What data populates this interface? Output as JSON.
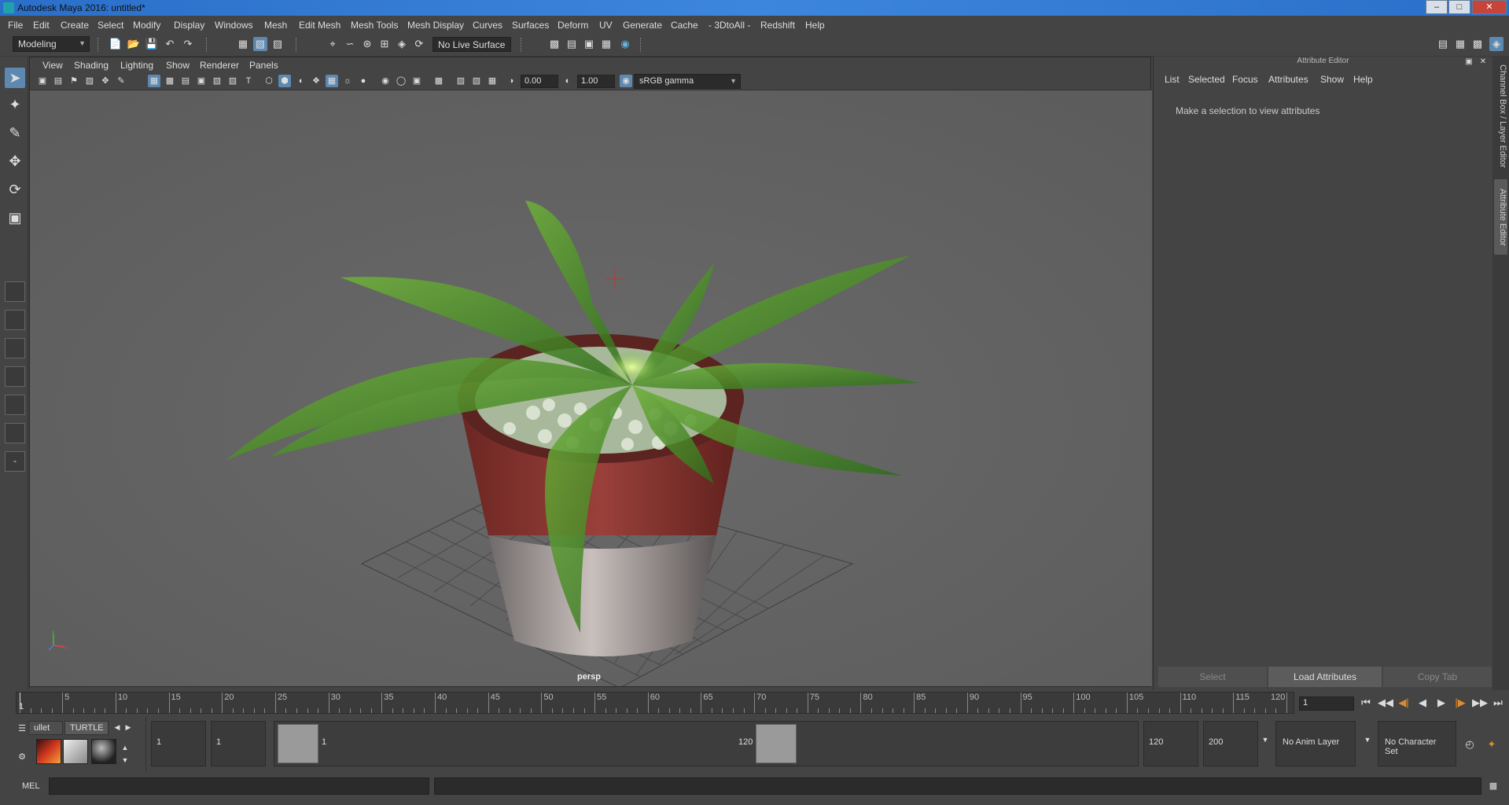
{
  "window": {
    "title": "Autodesk Maya 2016: untitled*"
  },
  "menubar": [
    "File",
    "Edit",
    "Create",
    "Select",
    "Modify",
    "Display",
    "Windows",
    "Mesh",
    "Edit Mesh",
    "Mesh Tools",
    "Mesh Display",
    "Curves",
    "Surfaces",
    "Deform",
    "UV",
    "Generate",
    "Cache",
    "- 3DtoAll -",
    "Redshift",
    "Help"
  ],
  "statusline": {
    "mode": "Modeling",
    "live_surface": "No Live Surface"
  },
  "viewport": {
    "menu": [
      "View",
      "Shading",
      "Lighting",
      "Show",
      "Renderer",
      "Panels"
    ],
    "exposure": "0.00",
    "gamma": "1.00",
    "color_space": "sRGB gamma",
    "camera": "persp"
  },
  "attribute_editor": {
    "title": "Attribute Editor",
    "menu": [
      "List",
      "Selected",
      "Focus",
      "Attributes",
      "Show",
      "Help"
    ],
    "message": "Make a selection to view attributes",
    "buttons": {
      "select": "Select",
      "load": "Load Attributes",
      "copy": "Copy Tab"
    }
  },
  "side_tabs": {
    "channel_box": "Channel Box / Layer Editor",
    "attribute_editor": "Attribute Editor"
  },
  "timeslider": {
    "ticks": [
      5,
      10,
      15,
      20,
      25,
      30,
      35,
      40,
      45,
      50,
      55,
      60,
      65,
      70,
      75,
      80,
      85,
      90,
      95,
      100,
      105,
      110,
      115,
      120
    ],
    "start_label": "1",
    "current_frame": "1"
  },
  "shelf": {
    "tabs": [
      "ullet",
      "TURTLE"
    ]
  },
  "range": {
    "start": "1",
    "playback_start": "1",
    "slider_start": "1",
    "slider_end": "120",
    "playback_end": "120",
    "end": "200",
    "anim_layer": "No Anim Layer",
    "character_set": "No Character Set"
  },
  "cmdline": {
    "label": "MEL"
  },
  "colors": {
    "accent": "#5d88b0",
    "titlebar": "#3d86dd",
    "leaf": "#4a9b2a",
    "pot": "#8a3a33"
  }
}
